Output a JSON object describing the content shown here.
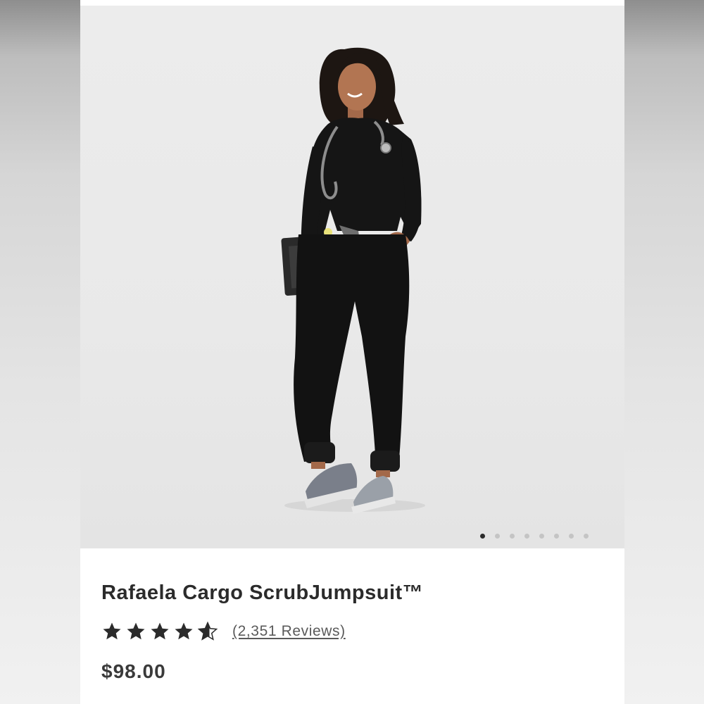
{
  "product": {
    "name": "Rafaela Cargo ScrubJumpsuit™",
    "rating_value": 4.5,
    "rating_max": 5,
    "reviews_label": "(2,351 Reviews)",
    "price": "$98.00"
  },
  "gallery": {
    "image_count": 8,
    "active_index": 0,
    "image_description_icon": "model-photo-icon"
  },
  "colors": {
    "text_primary": "#2b2b2b",
    "star": "#2b2b2b",
    "dot_active": "#2b2b2b",
    "dot_inactive": "#c4c4c4",
    "hero_background": "#ebebeb"
  }
}
